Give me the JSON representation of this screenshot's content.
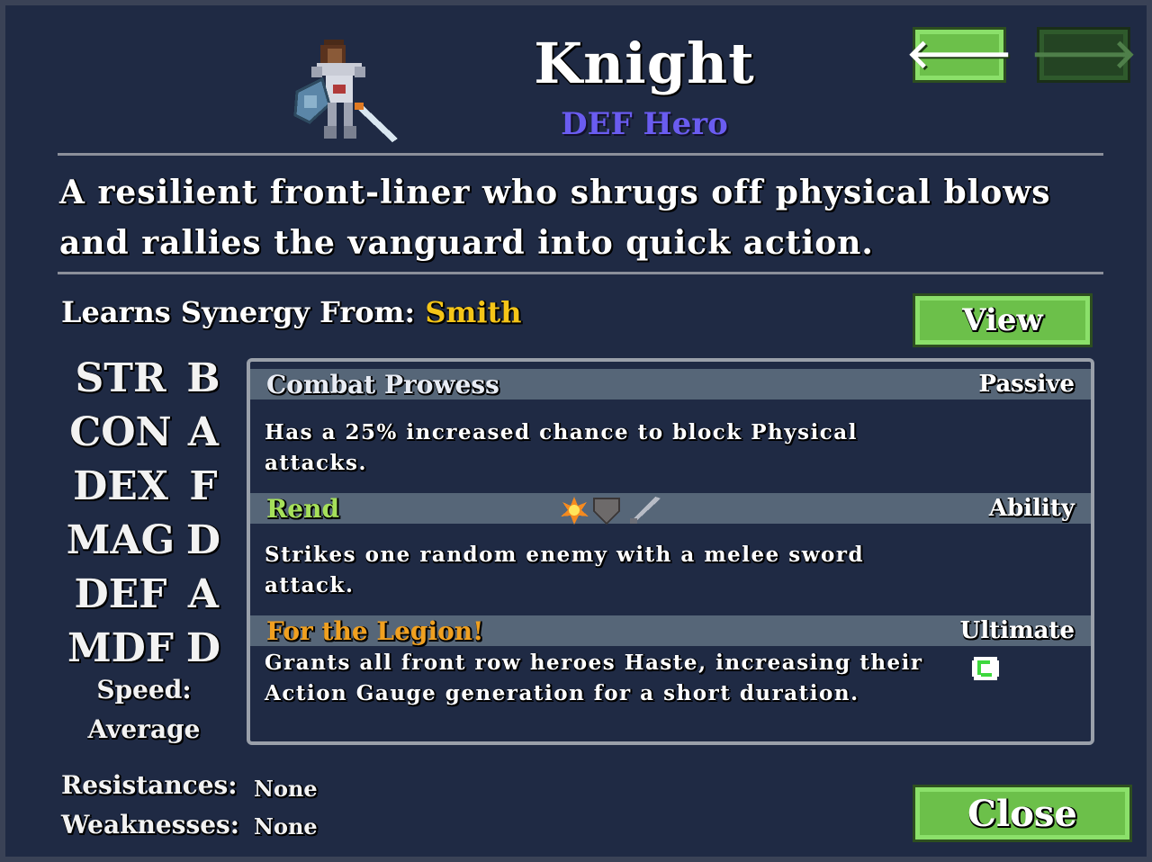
{
  "hero": {
    "name": "Knight",
    "role": "DEF Hero",
    "sprite_icon": "knight-sprite-icon",
    "description": "A resilient front-liner who shrugs off physical blows and rallies the vanguard into quick action."
  },
  "nav": {
    "prev_icon": "left-arrow-icon",
    "next_icon": "right-arrow-icon",
    "prev_glyph": "🡐",
    "next_glyph": "🡒"
  },
  "synergy": {
    "label": "Learns Synergy From:",
    "value": "Smith",
    "view_label": "View",
    "value_color": "#f5c518"
  },
  "stats": [
    {
      "name": "STR",
      "grade": "B"
    },
    {
      "name": "CON",
      "grade": "A"
    },
    {
      "name": "DEX",
      "grade": "F"
    },
    {
      "name": "MAG",
      "grade": "D"
    },
    {
      "name": "DEF",
      "grade": "A"
    },
    {
      "name": "MDF",
      "grade": "D"
    }
  ],
  "speed": {
    "label": "Speed:",
    "value": "Average"
  },
  "skills": [
    {
      "name": "Combat Prowess",
      "type": "Passive",
      "name_color": "#e8ecf4",
      "description": "Has a 25% increased chance to block Physical attacks."
    },
    {
      "name": "Rend",
      "type": "Ability",
      "name_color": "#a6e05a",
      "icons": [
        "fire-burst-icon",
        "shield-icon",
        "sword-icon"
      ],
      "description": "Strikes one random enemy with a melee sword attack."
    },
    {
      "name": "For the Legion!",
      "type": "Ultimate",
      "name_color": "#f0a020",
      "icons": [
        "haste-icon"
      ],
      "description": "Grants all front row heroes Haste, increasing their Action Gauge generation for a short duration."
    }
  ],
  "resistances": {
    "label": "Resistances:",
    "value": "None"
  },
  "weaknesses": {
    "label": "Weaknesses:",
    "value": "None"
  },
  "close_label": "Close",
  "colors": {
    "background": "#1f2a44",
    "button_green": "#6cc04a",
    "role_purple": "#6a5cf0"
  }
}
